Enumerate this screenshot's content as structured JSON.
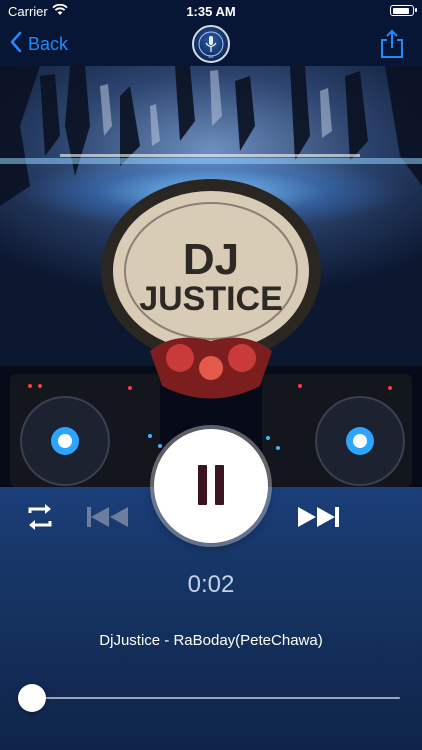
{
  "status_bar": {
    "carrier": "Carrier",
    "time": "1:35 AM"
  },
  "nav": {
    "back_label": "Back"
  },
  "logo": {
    "text": "DJ"
  },
  "artwork": {
    "line1": "DJ",
    "line2": "JUSTICE"
  },
  "player": {
    "elapsed": "0:02",
    "track_title": "DjJustice - RaBoday(PeteChawa)",
    "progress_fraction": 0.004
  },
  "colors": {
    "accent": "#1e8bff",
    "panel": "#173667",
    "nav": "#061634"
  }
}
